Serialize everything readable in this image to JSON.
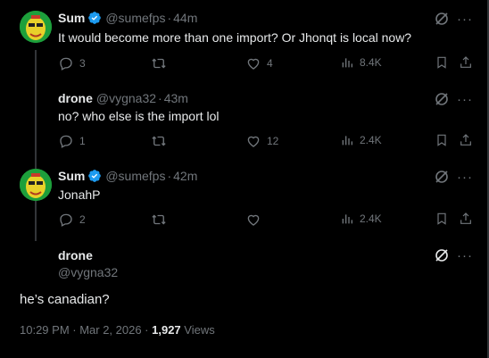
{
  "colors": {
    "background": "#000000",
    "text": "#e7e9ea",
    "muted": "#71767b",
    "verified": "#1d9bf0",
    "thread_line": "#333639"
  },
  "replies": [
    {
      "name": "Sum",
      "verified": true,
      "handle": "@sumefps",
      "dot": "·",
      "time": "44m",
      "text": "It would become more than one import? Or Jhonqt is local now?",
      "replies": "3",
      "reposts": "",
      "likes": "4",
      "views": "8.4K"
    },
    {
      "name": "drone",
      "verified": false,
      "handle": "@vygna32",
      "dot": "·",
      "time": "43m",
      "text": "no? who else is the import lol",
      "replies": "1",
      "reposts": "",
      "likes": "12",
      "views": "2.4K"
    },
    {
      "name": "Sum",
      "verified": true,
      "handle": "@sumefps",
      "dot": "·",
      "time": "42m",
      "text": "JonahP",
      "replies": "2",
      "reposts": "",
      "likes": "",
      "views": "2.4K"
    }
  ],
  "main_post": {
    "name": "drone",
    "handle": "@vygna32",
    "text": "he’s canadian?",
    "timestamp": "10:29 PM · Mar 2, 2026 · ",
    "views_count": "1,927",
    "views_label": " Views"
  },
  "icons": {
    "grok": "grok-icon",
    "more": "more-icon",
    "reply": "reply-icon",
    "repost": "repost-icon",
    "like": "like-icon",
    "views": "views-icon",
    "bookmark": "bookmark-icon",
    "share": "share-icon"
  }
}
